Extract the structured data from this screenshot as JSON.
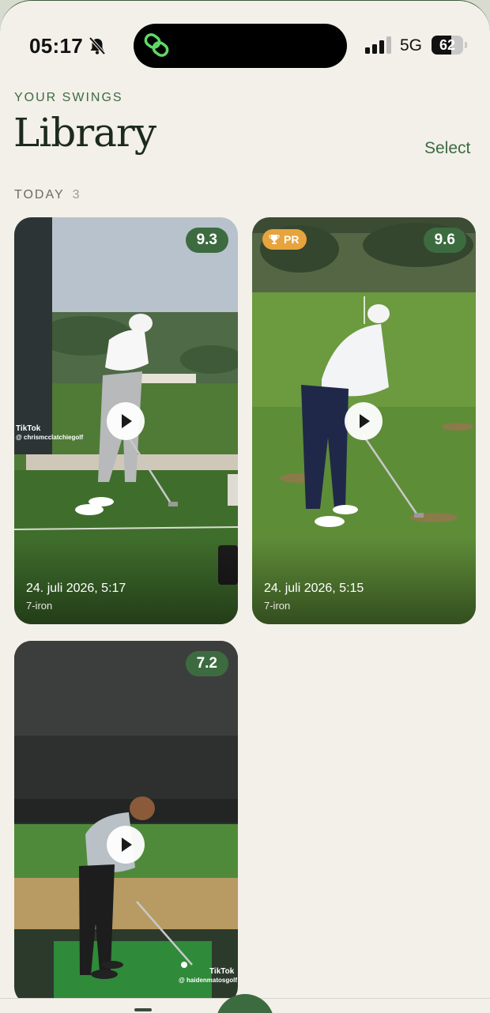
{
  "status": {
    "time": "05:17",
    "network": "5G",
    "battery": "62",
    "battery_level": 0.62,
    "icons": [
      "bell-slash-icon",
      "app-link-icon",
      "signal-icon"
    ]
  },
  "header": {
    "eyebrow": "YOUR SWINGS",
    "title": "Library",
    "select_label": "Select"
  },
  "section": {
    "label": "TODAY",
    "count": "3"
  },
  "swings": [
    {
      "score": "9.3",
      "date": "24. juli 2026, 5:17",
      "club": "7-iron",
      "watermark": "TikTok",
      "handle": "@ chrismcclatchiegolf"
    },
    {
      "score": "9.6",
      "badge": "PR",
      "date": "24. juli 2026, 5:15",
      "club": "7-iron"
    },
    {
      "score": "7.2",
      "watermark": "TikTok",
      "handle": "@ haidenmatosgolf"
    }
  ],
  "colors": {
    "accent": "#3d6b40",
    "badge_pr": "#e7a33c",
    "background": "#f2f0e8",
    "text_accent": "#3d6a44"
  }
}
